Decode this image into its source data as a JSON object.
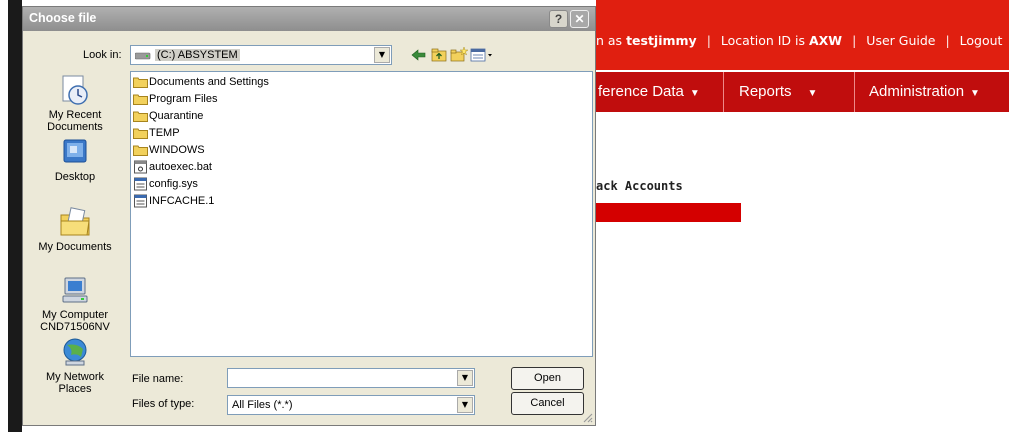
{
  "webpage": {
    "userbar": {
      "prefix": "n as",
      "username": "testjimmy",
      "location_text": "Location ID is",
      "location_id": "AXW",
      "user_guide": "User Guide",
      "logout": "Logout"
    },
    "nav": {
      "reference": "ference Data",
      "reports": "Reports",
      "administration": "Administration"
    },
    "section_title": "ack Accounts",
    "colors": {
      "brand_red": "#e01f10",
      "nav_red": "#c00d0d"
    }
  },
  "dialog": {
    "title": "Choose file",
    "help_label": "?",
    "close_label": "✕",
    "look_in_label": "Look in:",
    "look_in_value": "(C:) ABSYSTEM",
    "places": [
      {
        "label": "My Recent\nDocuments",
        "icon": "recent-documents-icon"
      },
      {
        "label": "Desktop",
        "icon": "desktop-icon"
      },
      {
        "label": "My Documents",
        "icon": "my-documents-icon"
      },
      {
        "label": "My Computer\nCND71506NV",
        "icon": "my-computer-icon"
      },
      {
        "label": "My Network\nPlaces",
        "icon": "network-places-icon"
      }
    ],
    "files": [
      {
        "name": "Documents and Settings",
        "type": "folder"
      },
      {
        "name": "Program Files",
        "type": "folder"
      },
      {
        "name": "Quarantine",
        "type": "folder"
      },
      {
        "name": "TEMP",
        "type": "folder"
      },
      {
        "name": "WINDOWS",
        "type": "folder"
      },
      {
        "name": "autoexec.bat",
        "type": "batch"
      },
      {
        "name": "config.sys",
        "type": "file"
      },
      {
        "name": "INFCACHE.1",
        "type": "file"
      }
    ],
    "file_name_label": "File name:",
    "file_name_value": "",
    "file_type_label": "Files of type:",
    "file_type_value": "All Files (*.*)",
    "open_label": "Open",
    "cancel_label": "Cancel"
  }
}
